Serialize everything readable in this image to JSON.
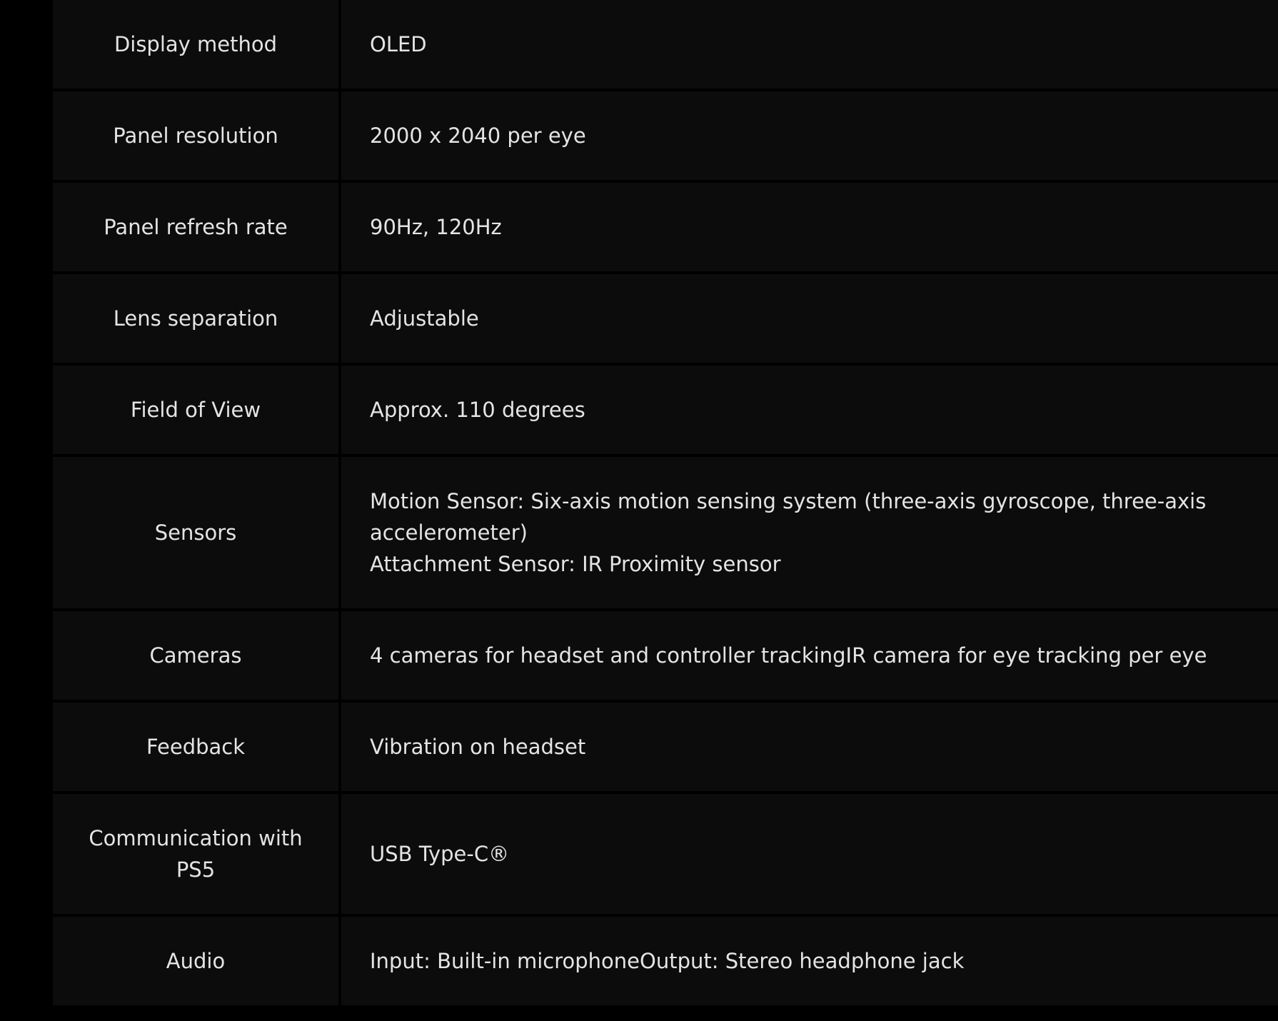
{
  "specs": {
    "rows": [
      {
        "label": "Display method",
        "value": [
          "OLED"
        ]
      },
      {
        "label": "Panel resolution",
        "value": [
          "2000 x 2040 per eye"
        ]
      },
      {
        "label": "Panel refresh rate",
        "value": [
          "90Hz, 120Hz"
        ]
      },
      {
        "label": "Lens separation",
        "value": [
          "Adjustable"
        ]
      },
      {
        "label": "Field of View",
        "value": [
          "Approx. 110 degrees"
        ]
      },
      {
        "label": "Sensors",
        "value": [
          "Motion Sensor: Six-axis motion sensing system (three-axis gyroscope, three-axis accelerometer)",
          "Attachment Sensor: IR Proximity sensor"
        ]
      },
      {
        "label": "Cameras",
        "value": [
          "4 cameras for headset and controller trackingIR camera for eye tracking per eye"
        ]
      },
      {
        "label": "Feedback",
        "value": [
          "Vibration on headset"
        ]
      },
      {
        "label": "Communication with PS5",
        "value": [
          "USB Type-C®"
        ]
      },
      {
        "label": "Audio",
        "value": [
          "Input: Built-in microphoneOutput: Stereo headphone jack"
        ]
      }
    ]
  },
  "colors": {
    "page_background": "#000000",
    "cell_background": "#0c0c0c",
    "text": "#e4e4e4"
  }
}
